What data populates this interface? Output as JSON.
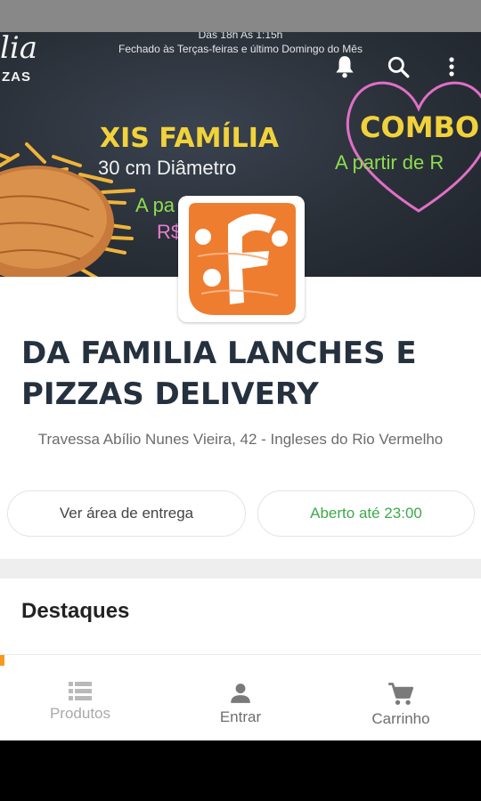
{
  "banner": {
    "hours_line1": "Das 18h As 1:15h",
    "hours_line2": "Fechado às Terças-feiras e último Domingo do Mês",
    "brand_fragment_top": "lia",
    "brand_fragment_bottom": "ZAS",
    "chalk_title": "XIS FAMÍLIA",
    "chalk_size": "30 cm Diâmetro",
    "chalk_price_partial": "A pa",
    "chalk_price_partial2": "R$",
    "combos_title": "COMBOS",
    "combos_sub": "A partir de R",
    "icons": [
      "bell-icon",
      "search-icon",
      "more-vert-icon"
    ]
  },
  "store": {
    "name": "DA FAMILIA LANCHES E PIZZAS DELIVERY",
    "address": "Travessa Abílio Nunes Vieira, 42 - Ingleses do Rio Vermelho",
    "delivery_area_button": "Ver área de entrega",
    "status": "Aberto até 23:00"
  },
  "sections": {
    "highlights_title": "Destaques"
  },
  "bottom_nav": {
    "items": [
      {
        "label": "Produtos",
        "icon": "list-icon"
      },
      {
        "label": "Entrar",
        "icon": "person-icon"
      },
      {
        "label": "Carrinho",
        "icon": "cart-icon"
      }
    ]
  },
  "colors": {
    "accent_orange": "#f39a1e",
    "logo_orange": "#ef7d2f",
    "open_green": "#3ea94b",
    "title_text": "#25313e"
  }
}
